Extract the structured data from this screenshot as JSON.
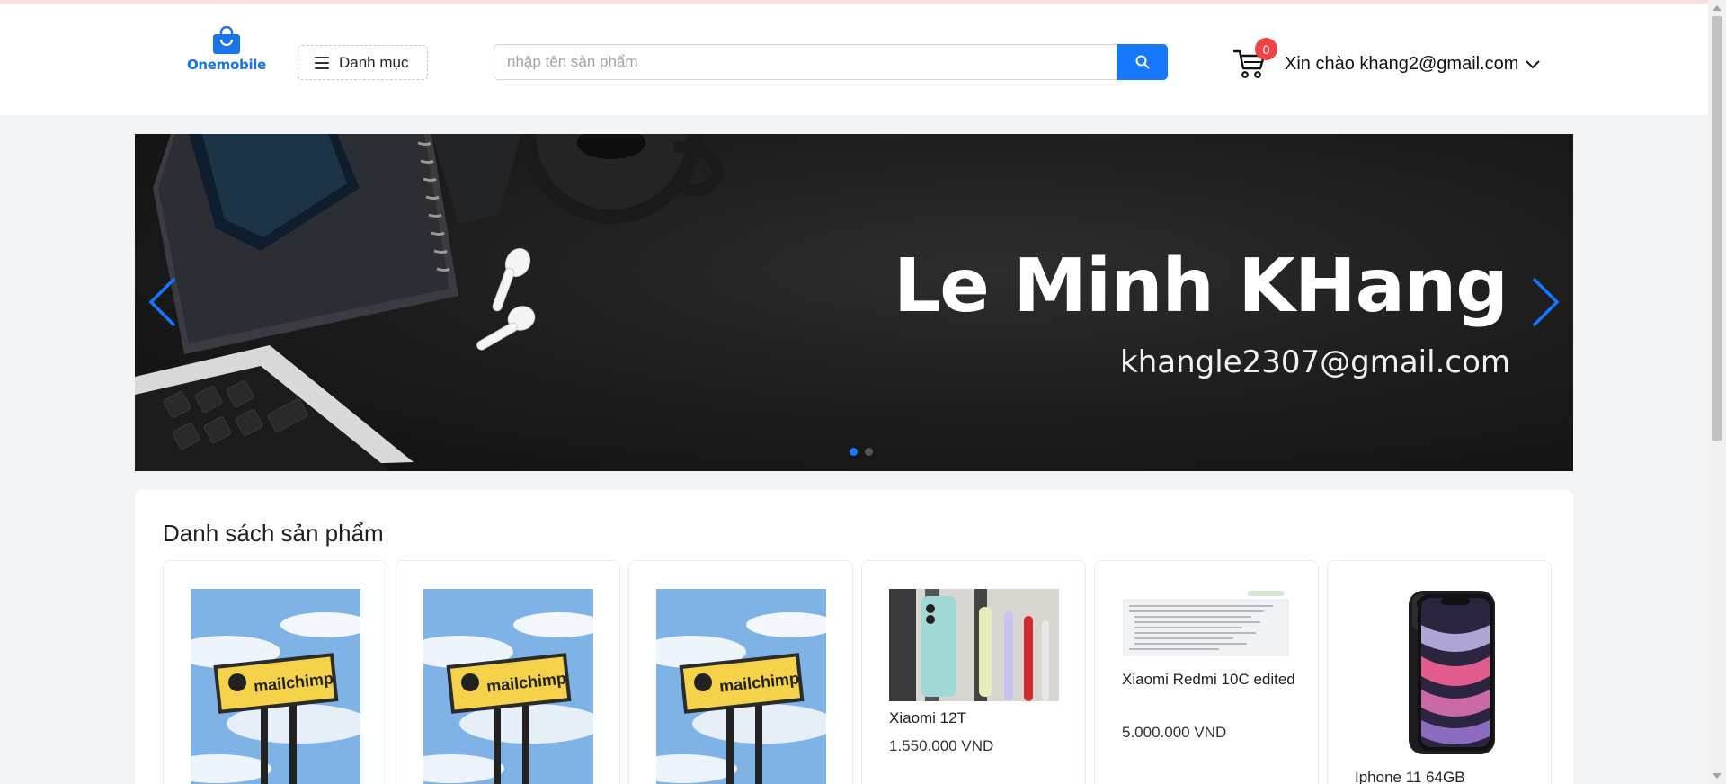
{
  "header": {
    "logo_text": "Onemobile",
    "category_label": "Danh mục",
    "search_placeholder": "nhập tên sản phẩm",
    "cart_count": "0",
    "greeting": "Xin chào khang2@gmail.com"
  },
  "banner": {
    "title": "Le Minh KHang",
    "email": "khangle2307@gmail.com",
    "slide_count": 2,
    "active_slide": 1
  },
  "products": {
    "heading": "Danh sách sản phẩm",
    "items": [
      {
        "name": "",
        "price": "",
        "image": "mailchimp-sign"
      },
      {
        "name": "",
        "price": "",
        "image": "mailchimp-sign"
      },
      {
        "name": "",
        "price": "",
        "image": "mailchimp-sign"
      },
      {
        "name": "Xiaomi 12T",
        "price": "1.550.000 VND",
        "image": "colorful-phones"
      },
      {
        "name": "Xiaomi Redmi 10C edited",
        "price": "5.000.000 VND",
        "image": "document-screenshot"
      },
      {
        "name": "Iphone 11 64GB",
        "price": "",
        "image": "black-iphone"
      }
    ]
  },
  "colors": {
    "accent": "#1677ff",
    "badge": "#ef4444",
    "logo": "#1a73e8"
  }
}
